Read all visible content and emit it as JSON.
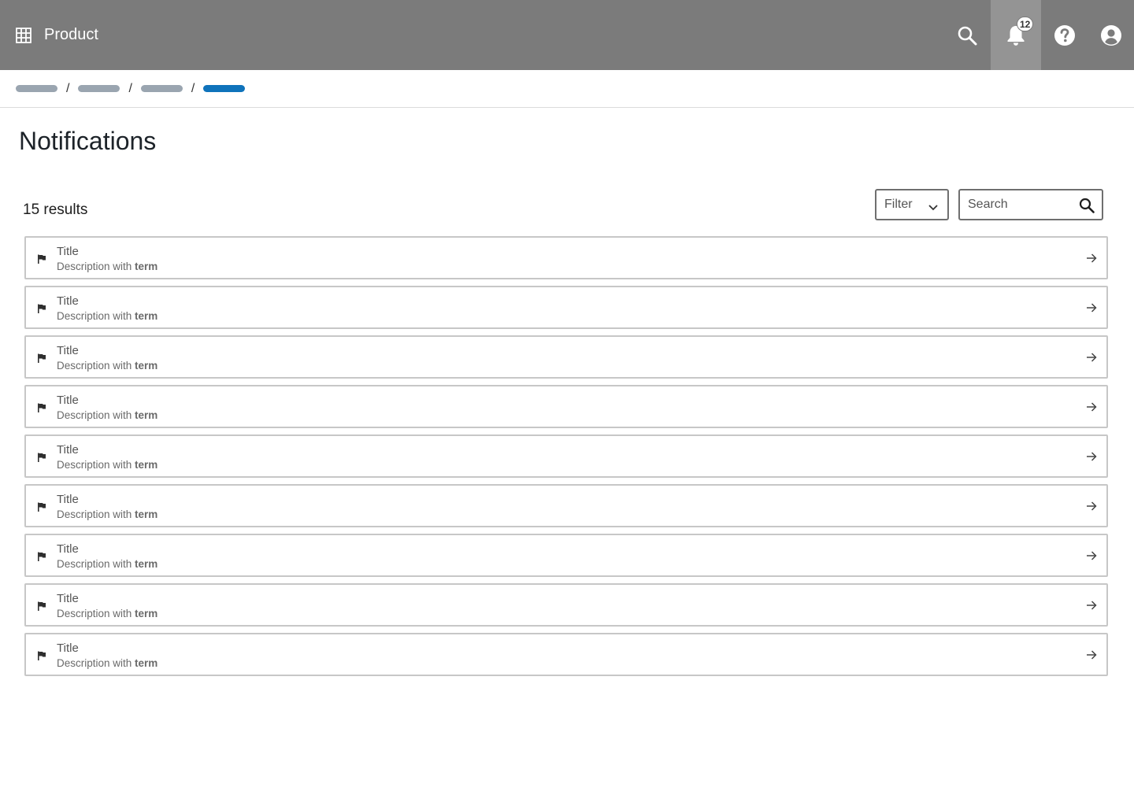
{
  "app": {
    "product_name": "Product"
  },
  "header": {
    "notifications_count": "12",
    "colors": {
      "bar": "#7b7b7b",
      "active": "#949494"
    }
  },
  "breadcrumb": {
    "separator": "/"
  },
  "page": {
    "title": "Notifications"
  },
  "toolbar": {
    "results": "15 results",
    "filter_label": "Filter",
    "search_placeholder": "Search"
  },
  "notifications": [
    {
      "title": "Title",
      "description": "Description with ",
      "term": "term"
    },
    {
      "title": "Title",
      "description": "Description with ",
      "term": "term"
    },
    {
      "title": "Title",
      "description": "Description with ",
      "term": "term"
    },
    {
      "title": "Title",
      "description": "Description with ",
      "term": "term"
    },
    {
      "title": "Title",
      "description": "Description with ",
      "term": "term"
    },
    {
      "title": "Title",
      "description": "Description with ",
      "term": "term"
    },
    {
      "title": "Title",
      "description": "Description with ",
      "term": "term"
    },
    {
      "title": "Title",
      "description": "Description with ",
      "term": "term"
    },
    {
      "title": "Title",
      "description": "Description with ",
      "term": "term"
    }
  ]
}
